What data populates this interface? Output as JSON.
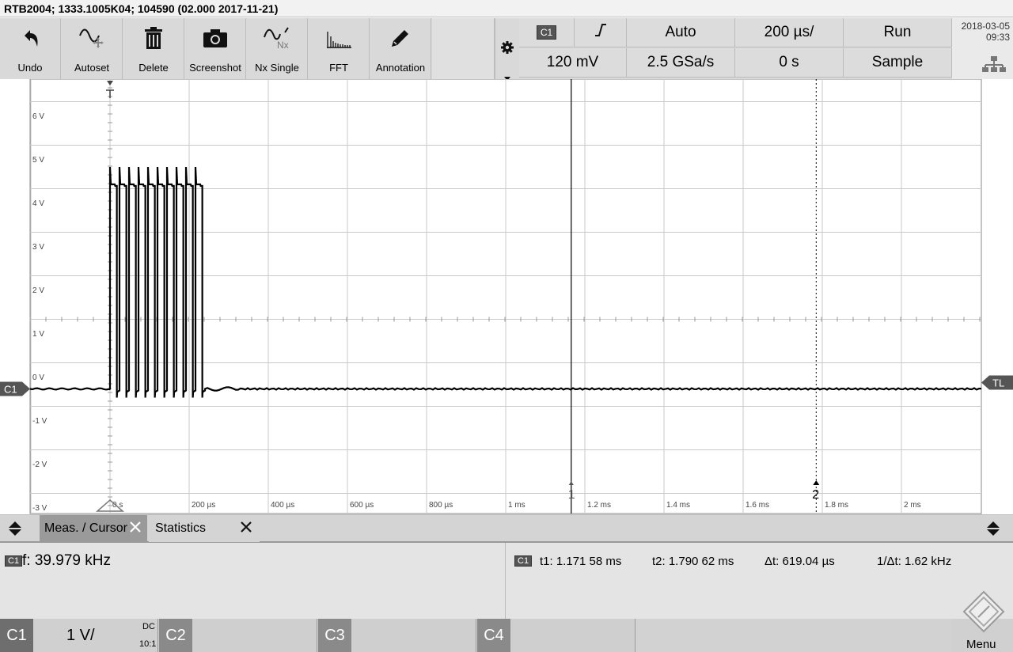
{
  "title": "RTB2004; 1333.1005K04; 104590 (02.000 2017-11-21)",
  "toolbar": {
    "buttons": [
      {
        "label": "Undo",
        "icon": "undo-icon"
      },
      {
        "label": "Autoset",
        "icon": "autoset-icon"
      },
      {
        "label": "Delete",
        "icon": "trash-icon"
      },
      {
        "label": "Screenshot",
        "icon": "camera-icon"
      },
      {
        "label": "Nx Single",
        "icon": "nx-single-icon"
      },
      {
        "label": "FFT",
        "icon": "fft-icon"
      },
      {
        "label": "Annotation",
        "icon": "pencil-icon"
      }
    ]
  },
  "trigger": {
    "channel": "C1",
    "edge_icon": "rising-edge-icon",
    "mode": "Auto",
    "timebase": "200 µs/",
    "run_state": "Run",
    "level": "120 mV",
    "sample_rate": "2.5 GSa/s",
    "position": "0 s",
    "acq_mode": "Sample"
  },
  "clock": {
    "date": "2018-03-05",
    "time": "09:33"
  },
  "plot": {
    "y_ticks": [
      "6 V",
      "5 V",
      "4 V",
      "3 V",
      "2 V",
      "1 V",
      "0 V",
      "-1 V",
      "-2 V",
      "-3 V"
    ],
    "x_ticks": [
      "0 s",
      "200 µs",
      "400 µs",
      "600 µs",
      "800 µs",
      "1 ms",
      "1.2 ms",
      "1.4 ms",
      "1.6 ms",
      "1.8 ms",
      "2 ms"
    ],
    "channel_marker": "C1",
    "trigger_level_marker": "TL",
    "cursor1_label": "1",
    "cursor2_label": "2"
  },
  "chart_data": {
    "type": "line",
    "xlabel": "",
    "ylabel": "",
    "xlim": [
      0,
      2.2
    ],
    "ylim": [
      -3,
      6
    ],
    "x_unit": "ms",
    "y_unit": "V",
    "burst": {
      "start_ms": 0.0,
      "end_ms": 0.24,
      "pulses": 10,
      "high_v": 4.6,
      "overshoot_v": 5.0,
      "low_v": -0.1,
      "undershoot_v": -0.3
    },
    "baseline_v": -0.1,
    "cursors_ms": [
      1.17158,
      1.79062
    ]
  },
  "tabs": [
    {
      "label": "Meas. / Cursor",
      "active": true
    },
    {
      "label": "Statistics",
      "active": false
    }
  ],
  "measurements": {
    "freq_channel": "C1",
    "freq": "f: 39.979 kHz",
    "cursor_channel": "C1",
    "t1": "t1: 1.171 58 ms",
    "t2": "t2: 1.790 62 ms",
    "dt": "Δt: 619.04 µs",
    "inv_dt": "1/Δt: 1.62 kHz"
  },
  "channels": [
    {
      "name": "C1",
      "scale": "1 V/",
      "coupling": "DC",
      "probe": "10:1"
    },
    {
      "name": "C2"
    },
    {
      "name": "C3"
    },
    {
      "name": "C4"
    }
  ],
  "menu_label": "Menu"
}
